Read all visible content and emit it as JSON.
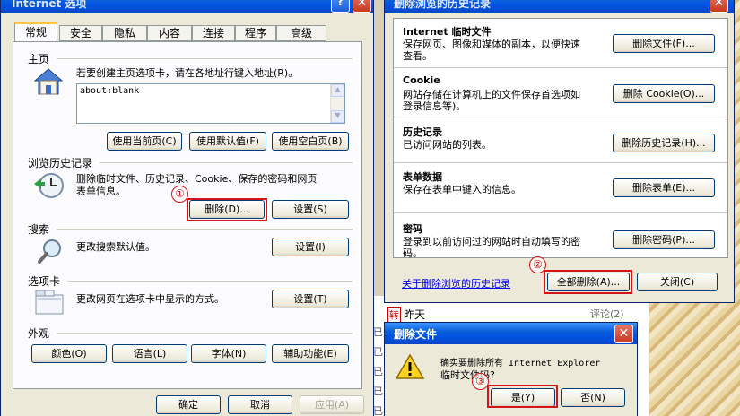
{
  "colors": {
    "accent_red": "#d3141b",
    "title_blue": "#0054e3",
    "dialog_bg": "#ece9d8",
    "link": "#0000ee"
  },
  "background": {
    "tag": "转",
    "item_text": "昨天",
    "comment": "评论(2)",
    "side_chars": [
      "已",
      "已",
      "已",
      "已",
      "已"
    ]
  },
  "internet_options": {
    "title": "Internet 选项",
    "help_label": "?",
    "close_label": "✕",
    "tabs": [
      "常规",
      "安全",
      "隐私",
      "内容",
      "连接",
      "程序",
      "高级"
    ],
    "home": {
      "group_label": "主页",
      "description": "若要创建主页选项卡，请在各地址行键入地址(R)。",
      "address_value": "about:blank",
      "buttons": [
        "使用当前页(C)",
        "使用默认值(F)",
        "使用空白页(B)"
      ]
    },
    "history": {
      "group_label": "浏览历史记录",
      "description_line1": "删除临时文件、历史记录、Cookie、保存的密码和网页",
      "description_line2": "表单信息。",
      "delete_button": "删除(D)...",
      "settings_button": "设置(S)"
    },
    "search": {
      "group_label": "搜索",
      "description": "更改搜索默认值。",
      "settings_button": "设置(I)"
    },
    "tabs_group": {
      "group_label": "选项卡",
      "description": "更改网页在选项卡中显示的方式。",
      "settings_button": "设置(T)"
    },
    "appearance": {
      "group_label": "外观",
      "buttons": [
        "颜色(O)",
        "语言(L)",
        "字体(N)",
        "辅助功能(E)"
      ]
    },
    "footer": {
      "ok": "确定",
      "cancel": "取消",
      "apply": "应用(A)"
    }
  },
  "delete_history": {
    "title": "删除浏览的历史记录",
    "close_label": "✕",
    "sections": [
      {
        "heading": "Internet 临时文件",
        "line1": "保存网页、图像和媒体的副本，以便快速",
        "line2": "查看。",
        "button": "删除文件(F)..."
      },
      {
        "heading": "Cookie",
        "line1": "网站存储在计算机上的文件保存首选项如",
        "line2": "登录信息等)。",
        "button": "删除 Cookie(O)..."
      },
      {
        "heading": "历史记录",
        "line1": "已访问网站的列表。",
        "line2": "",
        "button": "删除历史记录(H)..."
      },
      {
        "heading": "表单数据",
        "line1": "保存在表单中键入的信息。",
        "line2": "",
        "button": "删除表单(E)..."
      },
      {
        "heading": "密码",
        "line1": "登录到以前访问过的网站时自动填写的密",
        "line2": "码。",
        "button": "删除密码(P)..."
      }
    ],
    "about_link": "关于删除浏览的历史记录",
    "delete_all_button": "全部删除(A)...",
    "close_button": "关闭(C)"
  },
  "confirm": {
    "title": "删除文件",
    "close_label": "✕",
    "message_line1": "确实要删除所有 Internet Explorer",
    "message_line2": "临时文件吗?",
    "yes_button": "是(Y)",
    "no_button": "否(N)"
  },
  "markers": [
    "①",
    "②",
    "③"
  ]
}
